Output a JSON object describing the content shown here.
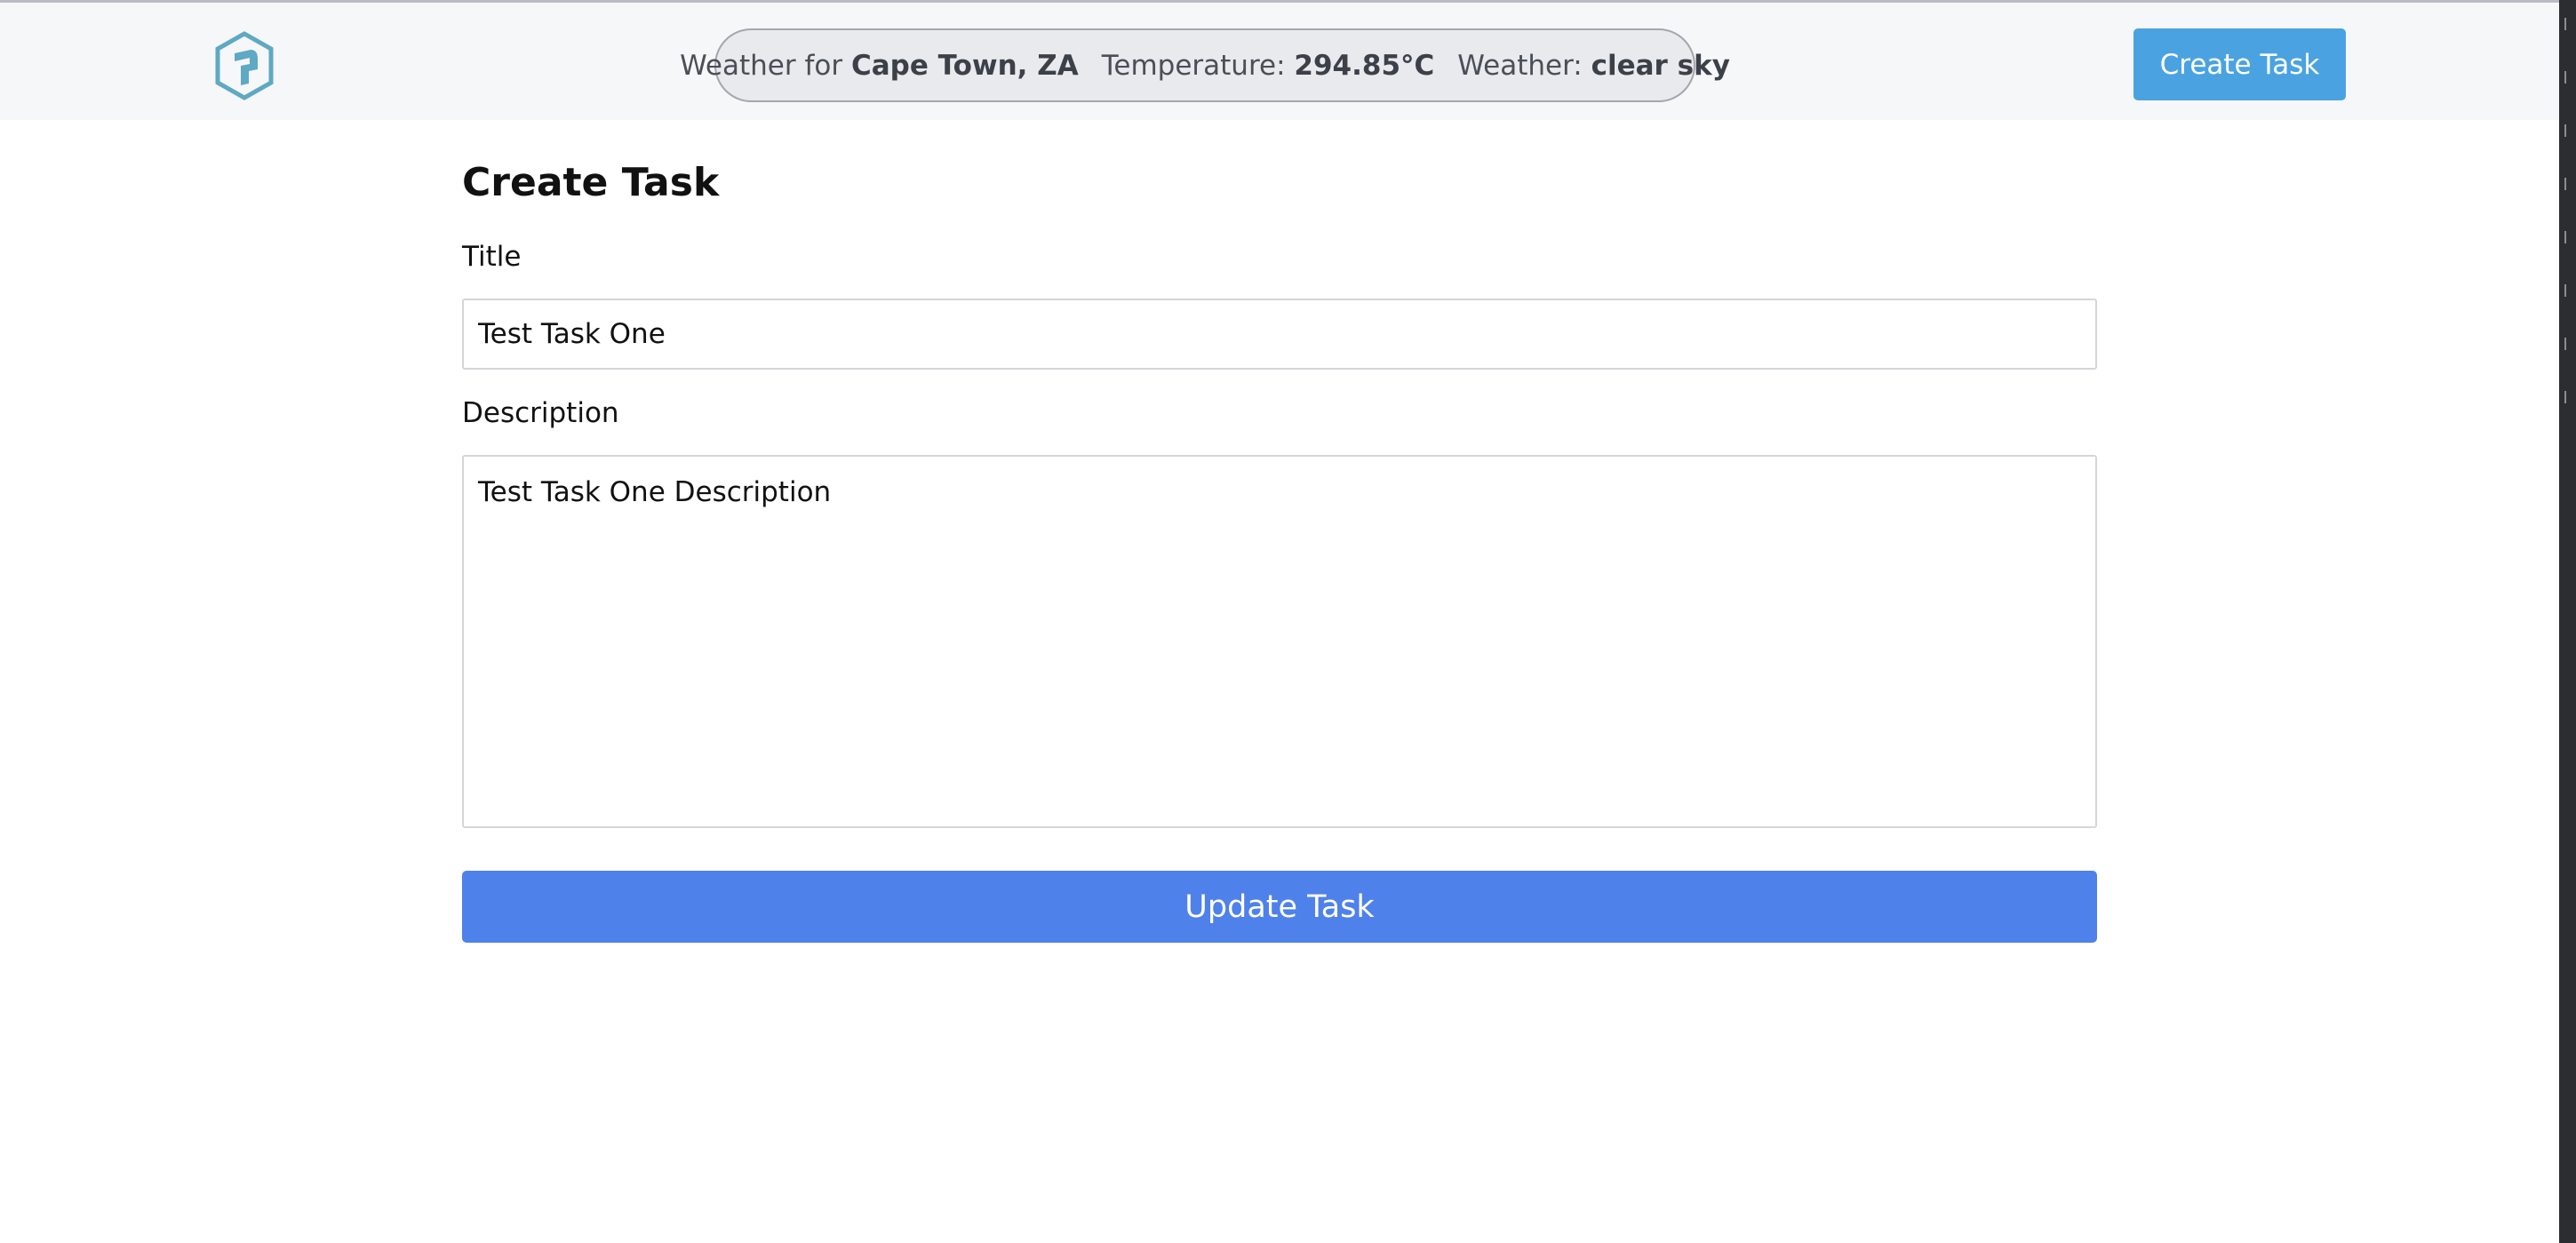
{
  "navbar": {
    "logo_icon": "hexagon-logo-icon",
    "weather": {
      "prefix": "Weather for",
      "location": "Cape Town, ZA",
      "temperature_label": "Temperature:",
      "temperature_value": "294.85°C",
      "condition_label": "Weather:",
      "condition_value": "clear sky"
    },
    "create_task_label": "Create Task"
  },
  "form": {
    "heading": "Create Task",
    "title_label": "Title",
    "title_value": "Test Task One",
    "description_label": "Description",
    "description_value": "Test Task One Description",
    "submit_label": "Update Task"
  },
  "colors": {
    "navbar_bg": "#f6f7f9",
    "nav_button": "#4aa3e0",
    "submit_button": "#4f81eb",
    "logo": "#5ea9c4"
  }
}
